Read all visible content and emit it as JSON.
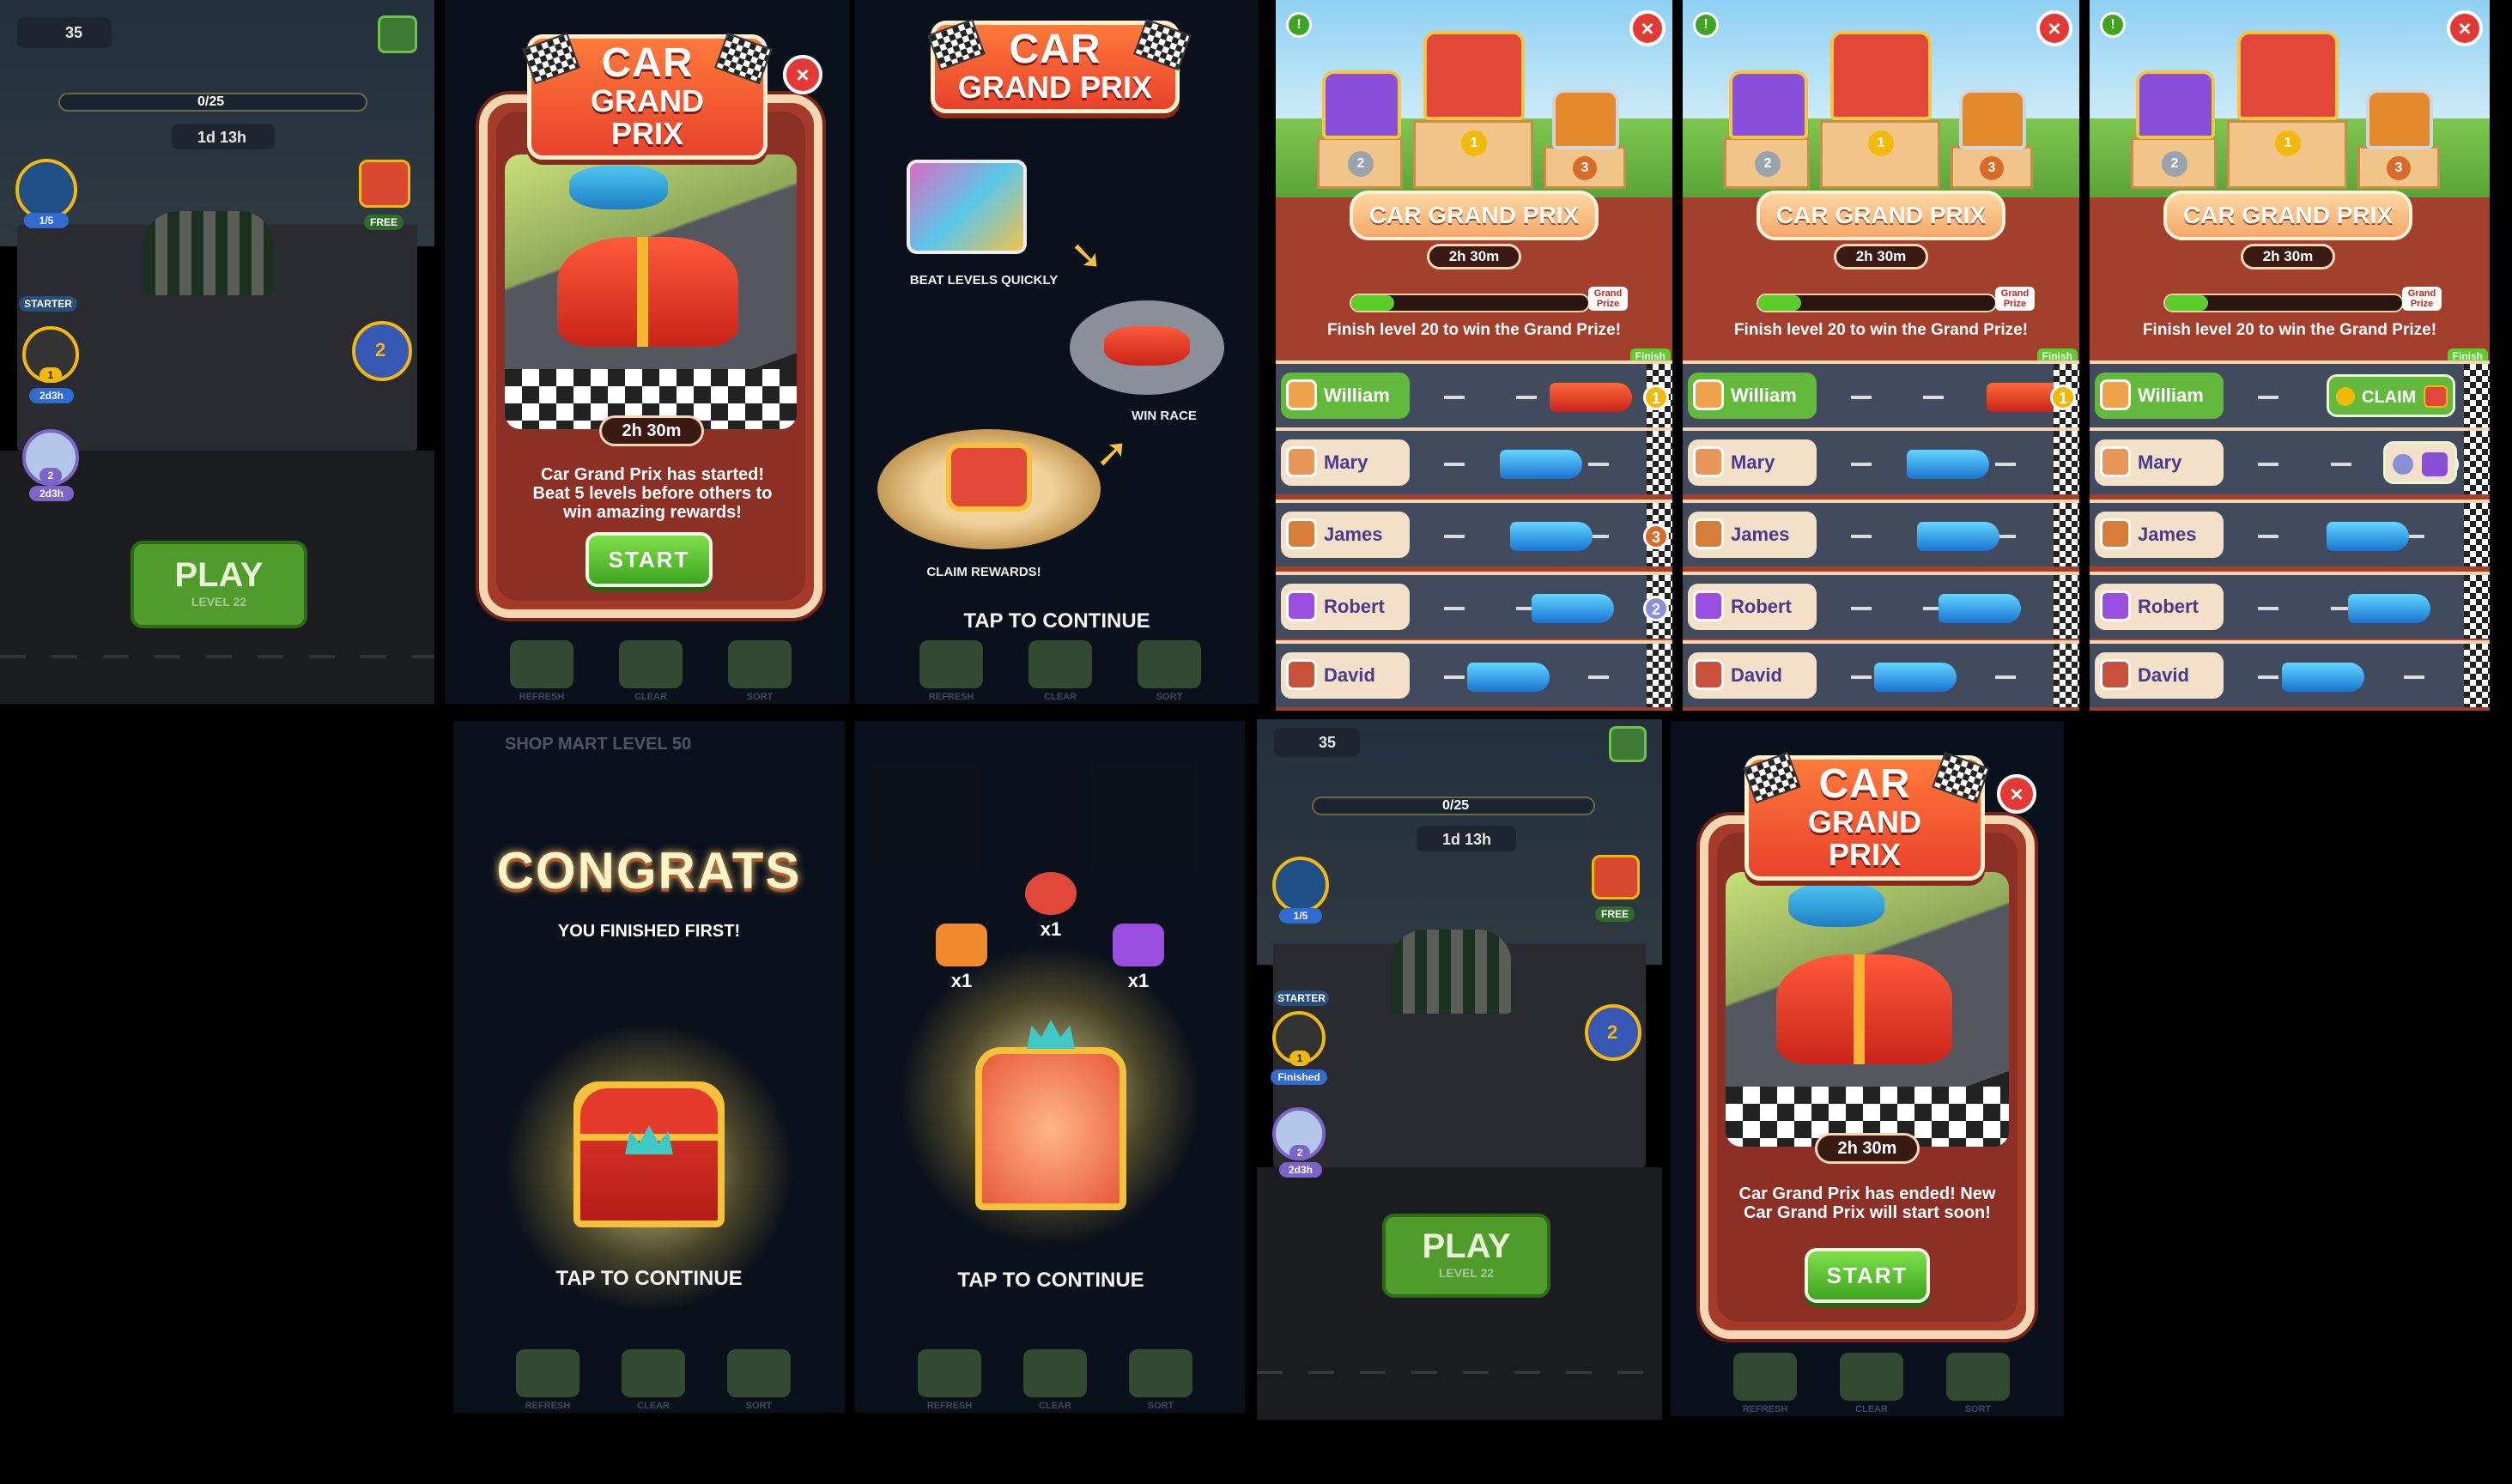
{
  "panel1": {
    "coins": "35",
    "progress": "0/25",
    "progress_fraction": 0.0,
    "timer": "1d 13h",
    "level_badge": "1/5",
    "starter": "STARTER",
    "free": "FREE",
    "event1_rank": "1",
    "event1_time": "2d3h",
    "event2_rank": "2",
    "event2_time": "2d3h",
    "rank_badge": "2",
    "play": "PLAY",
    "play_level": "LEVEL 22"
  },
  "intro_modal": {
    "logo_line1": "CAR",
    "logo_line2": "GRAND PRIX",
    "close": "×",
    "timer": "2h 30m",
    "message": "Car Grand Prix has started! Beat 5 levels before others to win amazing rewards!",
    "start": "START"
  },
  "tutorial": {
    "logo_line1": "CAR",
    "logo_line2": "GRAND PRIX",
    "step1": "BEAT LEVELS QUICKLY",
    "step2": "WIN RACE",
    "step3": "CLAIM REWARDS!",
    "tap": "TAP TO CONTINUE"
  },
  "leaderboard": {
    "title": "CAR GRAND PRIX",
    "timer": "2h 30m",
    "goal_label": "Grand Prize",
    "message": "Finish level 20 to win the Grand Prize!",
    "finish": "Finish",
    "pedestal": [
      "2",
      "1",
      "3"
    ],
    "claim": "CLAIM",
    "players": [
      "William",
      "Mary",
      "James",
      "Robert",
      "David"
    ]
  },
  "lb_states": [
    {
      "bar_fraction": 0.18,
      "car_pos": [
        0.78,
        0.55,
        0.6,
        0.7,
        0.4
      ],
      "ranks": [
        "1",
        "",
        "3",
        "2",
        ""
      ]
    },
    {
      "bar_fraction": 0.18,
      "car_pos": [
        0.92,
        0.55,
        0.6,
        0.7,
        0.4
      ],
      "ranks": [
        "1",
        "",
        "",
        "",
        ""
      ]
    },
    {
      "bar_fraction": 0.18,
      "car_pos": [
        0.0,
        0.0,
        0.6,
        0.7,
        0.4
      ],
      "ranks": [
        "",
        "2",
        "",
        "",
        ""
      ]
    }
  ],
  "congrats": {
    "shop_header": "SHOP MART LEVEL 50",
    "title": "CONGRATS",
    "subtitle": "YOU FINISHED FIRST!",
    "tap": "TAP TO CONTINUE"
  },
  "rewards": {
    "items": [
      "x1",
      "x1",
      "x1"
    ],
    "tap": "TAP TO CONTINUE"
  },
  "panel9": {
    "coins": "35",
    "progress": "0/25",
    "timer": "1d 13h",
    "level_badge": "1/5",
    "starter": "STARTER",
    "free": "FREE",
    "event1_rank": "1",
    "event1_label": "Finished",
    "event2_rank": "2",
    "event2_time": "2d3h",
    "rank_badge": "2",
    "play": "PLAY",
    "play_level": "LEVEL 22"
  },
  "end_modal": {
    "logo_line1": "CAR",
    "logo_line2": "GRAND PRIX",
    "close": "×",
    "timer": "2h 30m",
    "message": "Car Grand Prix has ended! New Car Grand Prix will start soon!",
    "start": "START"
  },
  "bottom_bar": [
    "REFRESH",
    "CLEAR",
    "SORT"
  ],
  "colors": {
    "accent_red": "#e53935",
    "start_green": "#4fb52a",
    "modal_red": "#a33a2a",
    "gold": "#f7c23a"
  }
}
